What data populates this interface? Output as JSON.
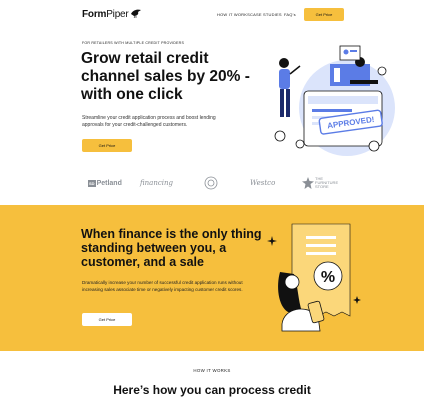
{
  "nav": {
    "logo_bold": "Form",
    "logo_light": "Piper",
    "links": [
      "HOW IT WORKS",
      "CASE STUDIES",
      "FAQ's"
    ],
    "cta": "Get Price"
  },
  "hero": {
    "eyebrow": "FOR RETAILERS WITH MULTIPLE CREDIT PROVIDERS",
    "title": "Grow retail credit channel sales by 20% - with one click",
    "subtitle": "Streamline your credit application process and boost lending approvals for your credit-challenged customers.",
    "cta": "Get Price",
    "stamp": "APPROVED!"
  },
  "partners": {
    "p1_box": "SD",
    "p1": "Petland",
    "p2": "financing",
    "p4": "Westco",
    "p5": "THE FURNITURE STORE"
  },
  "band": {
    "title": "When finance is the only thing standing between you, a customer, and a sale",
    "subtitle": "Dramatically increase your number of successful credit application runs without increasing sales associate time or negatively impacting customer credit scores.",
    "cta": "Get Price",
    "percent": "%"
  },
  "how": {
    "eyebrow": "HOW IT WORKS",
    "title": "Here’s how you can process credit"
  },
  "colors": {
    "accent": "#f6bf3d",
    "illustration_blue": "#5b7ce6",
    "illustration_light": "#dbe4fb"
  }
}
